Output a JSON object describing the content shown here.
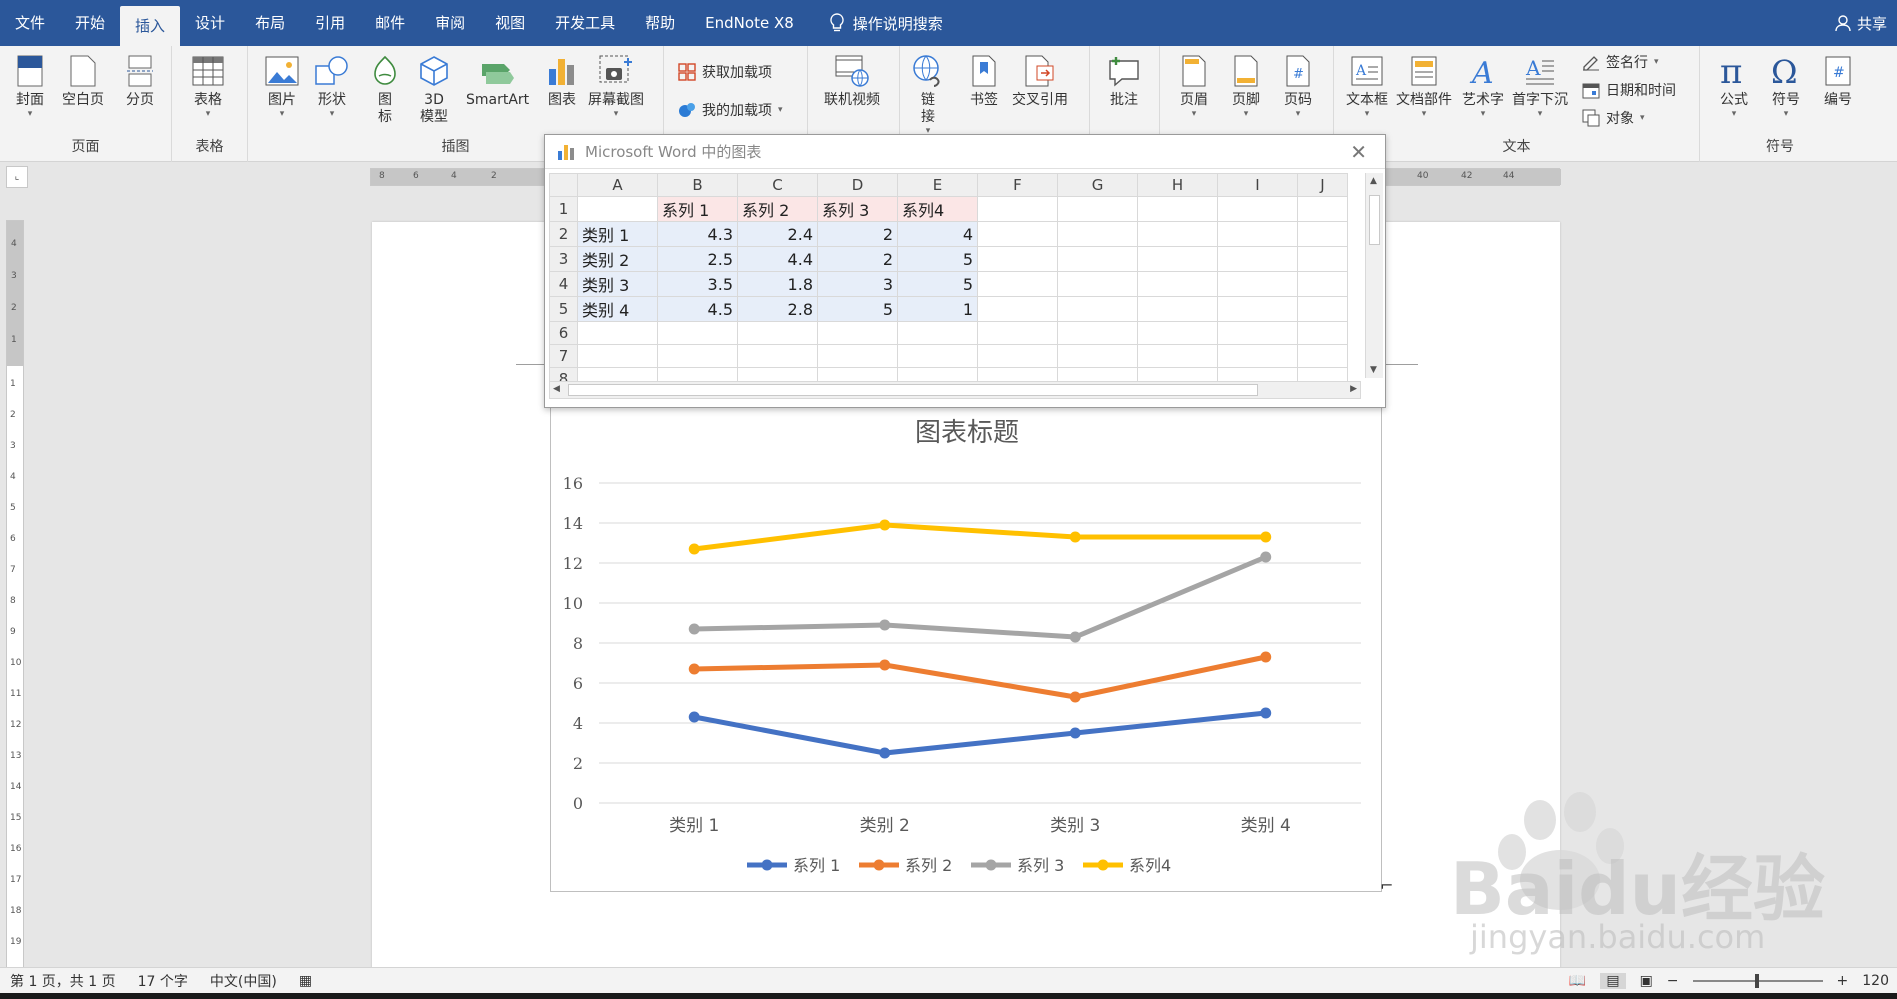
{
  "menu": {
    "tabs": [
      "文件",
      "开始",
      "插入",
      "设计",
      "布局",
      "引用",
      "邮件",
      "审阅",
      "视图",
      "开发工具",
      "帮助",
      "EndNote X8"
    ],
    "active_tab": "插入",
    "tell_me": "操作说明搜索",
    "share": "共享"
  },
  "ribbon": {
    "pages": {
      "label": "页面",
      "cover": "封面",
      "blank": "空白页",
      "break": "分页"
    },
    "tables": {
      "label": "表格",
      "table": "表格"
    },
    "illustrations": {
      "label": "插图",
      "picture": "图片",
      "shapes": "形状",
      "icons": "图\n标",
      "model3d": "3D\n模型",
      "smartart": "SmartArt",
      "chart": "图表",
      "screenshot": "屏幕截图"
    },
    "addins": {
      "get": "获取加载项",
      "mine": "我的加载项"
    },
    "media": {
      "online_video": "联机视频"
    },
    "links": {
      "link": "链\n接",
      "bookmark": "书签",
      "crossref": "交叉引用"
    },
    "comments": {
      "comment": "批注"
    },
    "header_footer": {
      "header": "页眉",
      "footer": "页脚",
      "page_number": "页码"
    },
    "text": {
      "label": "文本",
      "textbox": "文本框",
      "parts": "文档部件",
      "wordart": "艺术字",
      "dropcap": "首字下沉",
      "signature": "签名行",
      "datetime": "日期和时间",
      "object": "对象"
    },
    "symbols": {
      "label": "符号",
      "equation": "公式",
      "symbol": "符号",
      "number": "编号"
    }
  },
  "ruler": {
    "h_left": [
      "8",
      "6",
      "4",
      "2"
    ],
    "h_right": [
      "40",
      "42",
      "44"
    ],
    "v_top": [
      "4",
      "3",
      "2",
      "1"
    ],
    "v_main": [
      "1",
      "2",
      "3",
      "4",
      "5",
      "6",
      "7",
      "8",
      "9",
      "10",
      "11",
      "12",
      "13",
      "14",
      "15",
      "16",
      "17",
      "18",
      "19"
    ]
  },
  "sheet": {
    "title": "Microsoft Word 中的图表",
    "columns": [
      "A",
      "B",
      "C",
      "D",
      "E",
      "F",
      "G",
      "H",
      "I",
      "J"
    ],
    "rows": [
      "1",
      "2",
      "3",
      "4",
      "5",
      "6",
      "7",
      "8"
    ],
    "header_row": [
      "",
      "系列 1",
      "系列 2",
      "系列 3",
      "系列4"
    ],
    "data": [
      [
        "类别 1",
        "4.3",
        "2.4",
        "2",
        "4"
      ],
      [
        "类别 2",
        "2.5",
        "4.4",
        "2",
        "5"
      ],
      [
        "类别 3",
        "3.5",
        "1.8",
        "3",
        "5"
      ],
      [
        "类别 4",
        "4.5",
        "2.8",
        "5",
        "1"
      ]
    ]
  },
  "chart_data": {
    "type": "line",
    "stacked": true,
    "title": "图表标题",
    "categories": [
      "类别 1",
      "类别 2",
      "类别 3",
      "类别 4"
    ],
    "series": [
      {
        "name": "系列 1",
        "values": [
          4.3,
          2.5,
          3.5,
          4.5
        ],
        "color": "#4472c4"
      },
      {
        "name": "系列 2",
        "values": [
          2.4,
          4.4,
          1.8,
          2.8
        ],
        "color": "#ed7d31"
      },
      {
        "name": "系列 3",
        "values": [
          2,
          2,
          3,
          5
        ],
        "color": "#a5a5a5"
      },
      {
        "name": "系列4",
        "values": [
          4,
          5,
          5,
          1
        ],
        "color": "#ffc000"
      }
    ],
    "yticks": [
      "0",
      "2",
      "4",
      "6",
      "8",
      "10",
      "12",
      "14",
      "16"
    ],
    "ylim": [
      0,
      16
    ],
    "grid": true,
    "legend": "bottom"
  },
  "status": {
    "page": "第 1 页，共 1 页",
    "words": "17 个字",
    "lang": "中文(中国)",
    "zoom": "120"
  },
  "watermark": {
    "brand": "Baidu经验",
    "url": "jingyan.baidu.com"
  }
}
